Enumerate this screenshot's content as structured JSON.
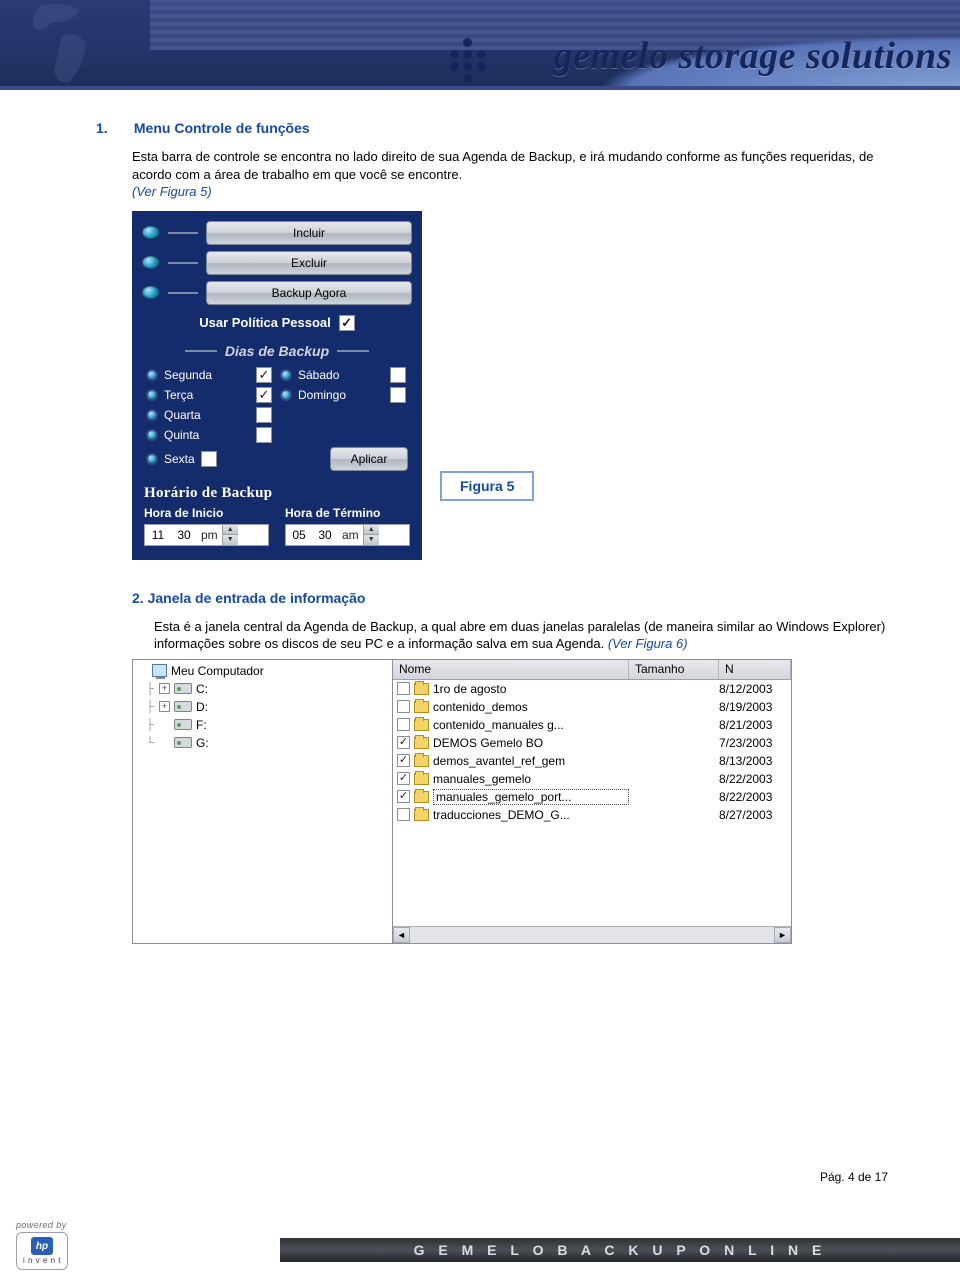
{
  "banner": {
    "brand": "gemelo storage solutions"
  },
  "section1": {
    "num": "1.",
    "title": "Menu Controle de funções",
    "body": "Esta barra de controle se encontra no lado direito de sua Agenda de Backup, e irá mudando conforme as funções requeridas, de acordo com a área de trabalho em que você se encontre.",
    "ref": "(Ver Figura 5)"
  },
  "fig5": {
    "buttons": {
      "incluir": "Incluir",
      "excluir": "Excluir",
      "backup_agora": "Backup Agora"
    },
    "usar_politica": "Usar Política Pessoal",
    "usar_politica_checked": true,
    "dias_header": "Dias de Backup",
    "days": {
      "segunda": {
        "label": "Segunda",
        "checked": true
      },
      "sabado": {
        "label": "Sábado",
        "checked": false
      },
      "terca": {
        "label": "Terça",
        "checked": true
      },
      "domingo": {
        "label": "Domingo",
        "checked": false
      },
      "quarta": {
        "label": "Quarta",
        "checked": false
      },
      "quinta": {
        "label": "Quinta",
        "checked": false
      },
      "sexta": {
        "label": "Sexta",
        "checked": false
      }
    },
    "aplicar": "Aplicar",
    "horario_header": "Horário de Backup",
    "inicio_label": "Hora de Inicio",
    "termino_label": "Hora de Término",
    "time_inicio": {
      "hh": "11",
      "mm": "30",
      "ampm": "pm"
    },
    "time_termino": {
      "hh": "05",
      "mm": "30",
      "ampm": "am"
    },
    "caption": "Figura      5"
  },
  "section2": {
    "num": "2.",
    "title": "Janela de entrada de informação",
    "body": "Esta é a janela central da Agenda de Backup, a qual abre em duas janelas paralelas (de maneira similar ao Windows Explorer) informações sobre os discos de seu PC e a informação salva em sua Agenda.",
    "ref": "(Ver Figura 6)"
  },
  "fig6": {
    "tree": {
      "root": "Meu Computador",
      "drives": [
        "C:",
        "D:",
        "F:",
        "G:"
      ]
    },
    "columns": {
      "name": "Nome",
      "size": "Tamanho",
      "date": "N"
    },
    "rows": [
      {
        "checked": false,
        "name": "1ro de agosto",
        "date": "8/12/2003"
      },
      {
        "checked": false,
        "name": "contenido_demos",
        "date": "8/19/2003"
      },
      {
        "checked": false,
        "name": "contenido_manuales g...",
        "date": "8/21/2003"
      },
      {
        "checked": true,
        "name": "DEMOS Gemelo BO",
        "date": "7/23/2003"
      },
      {
        "checked": true,
        "name": "demos_avantel_ref_gem",
        "date": "8/13/2003"
      },
      {
        "checked": true,
        "name": "manuales_gemelo",
        "date": "8/22/2003"
      },
      {
        "checked": true,
        "name": "manuales_gemelo_port...",
        "date": "8/22/2003",
        "focused": true
      },
      {
        "checked": false,
        "name": "traducciones_DEMO_G...",
        "date": "8/27/2003"
      }
    ]
  },
  "footer": {
    "page": "Pág. 4 de 17",
    "powered_by": "powered by",
    "hp": "hp",
    "invent": "i n v e n t",
    "bar": "G E M E L O   B A C K U P   O N L I N E"
  }
}
